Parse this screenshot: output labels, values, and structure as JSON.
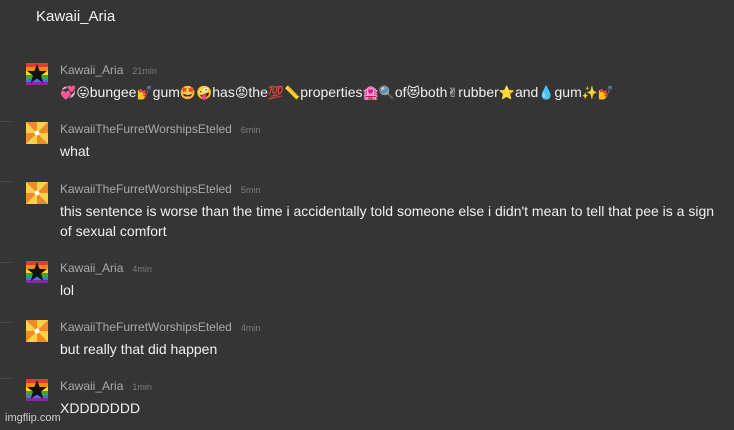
{
  "chat": {
    "title": "Kawaii_Aria"
  },
  "messages": [
    {
      "author": "Kawaii_Aria",
      "time": "21min",
      "avatar": "rainbow-star-avatar",
      "segments": [
        {
          "emoji": "💞"
        },
        {
          "emoji": "😛"
        },
        {
          "text": "bungee"
        },
        {
          "emoji": "💅"
        },
        {
          "text": "gum"
        },
        {
          "emoji": "🤩"
        },
        {
          "emoji": "🤪"
        },
        {
          "text": "has"
        },
        {
          "emoji": "😡"
        },
        {
          "text": "the"
        },
        {
          "emoji": "💯"
        },
        {
          "emoji": "📏"
        },
        {
          "text": "properties"
        },
        {
          "emoji": "🏩"
        },
        {
          "emoji": "🔍"
        },
        {
          "text": "of"
        },
        {
          "emoji": "😻"
        },
        {
          "text": "both"
        },
        {
          "emoji": "✌"
        },
        {
          "text": "rubber"
        },
        {
          "emoji": "⭐"
        },
        {
          "text": "and"
        },
        {
          "emoji": "💧"
        },
        {
          "text": "gum"
        },
        {
          "emoji": "✨"
        },
        {
          "emoji": "💅"
        }
      ]
    },
    {
      "author": "KawaiiTheFurretWorshipsEteled",
      "time": "6min",
      "avatar": "orange-pinwheel-avatar",
      "text": "what"
    },
    {
      "author": "KawaiiTheFurretWorshipsEteled",
      "time": "5min",
      "avatar": "orange-pinwheel-avatar",
      "text": "this sentence is worse than the time i accidentally told someone else i didn't mean to tell that pee is a sign of sexual comfort"
    },
    {
      "author": "Kawaii_Aria",
      "time": "4min",
      "avatar": "rainbow-star-avatar",
      "text": "lol"
    },
    {
      "author": "KawaiiTheFurretWorshipsEteled",
      "time": "4min",
      "avatar": "orange-pinwheel-avatar",
      "text": "but really that did happen"
    },
    {
      "author": "Kawaii_Aria",
      "time": "1min",
      "avatar": "rainbow-star-avatar",
      "text": "XDDDDDDD"
    }
  ],
  "watermark": "imgflip.com",
  "colors": {
    "background": "#353535",
    "author_text": "#a9a9a9",
    "message_text": "#f0f0f0",
    "timestamp": "#7d7d7d"
  }
}
